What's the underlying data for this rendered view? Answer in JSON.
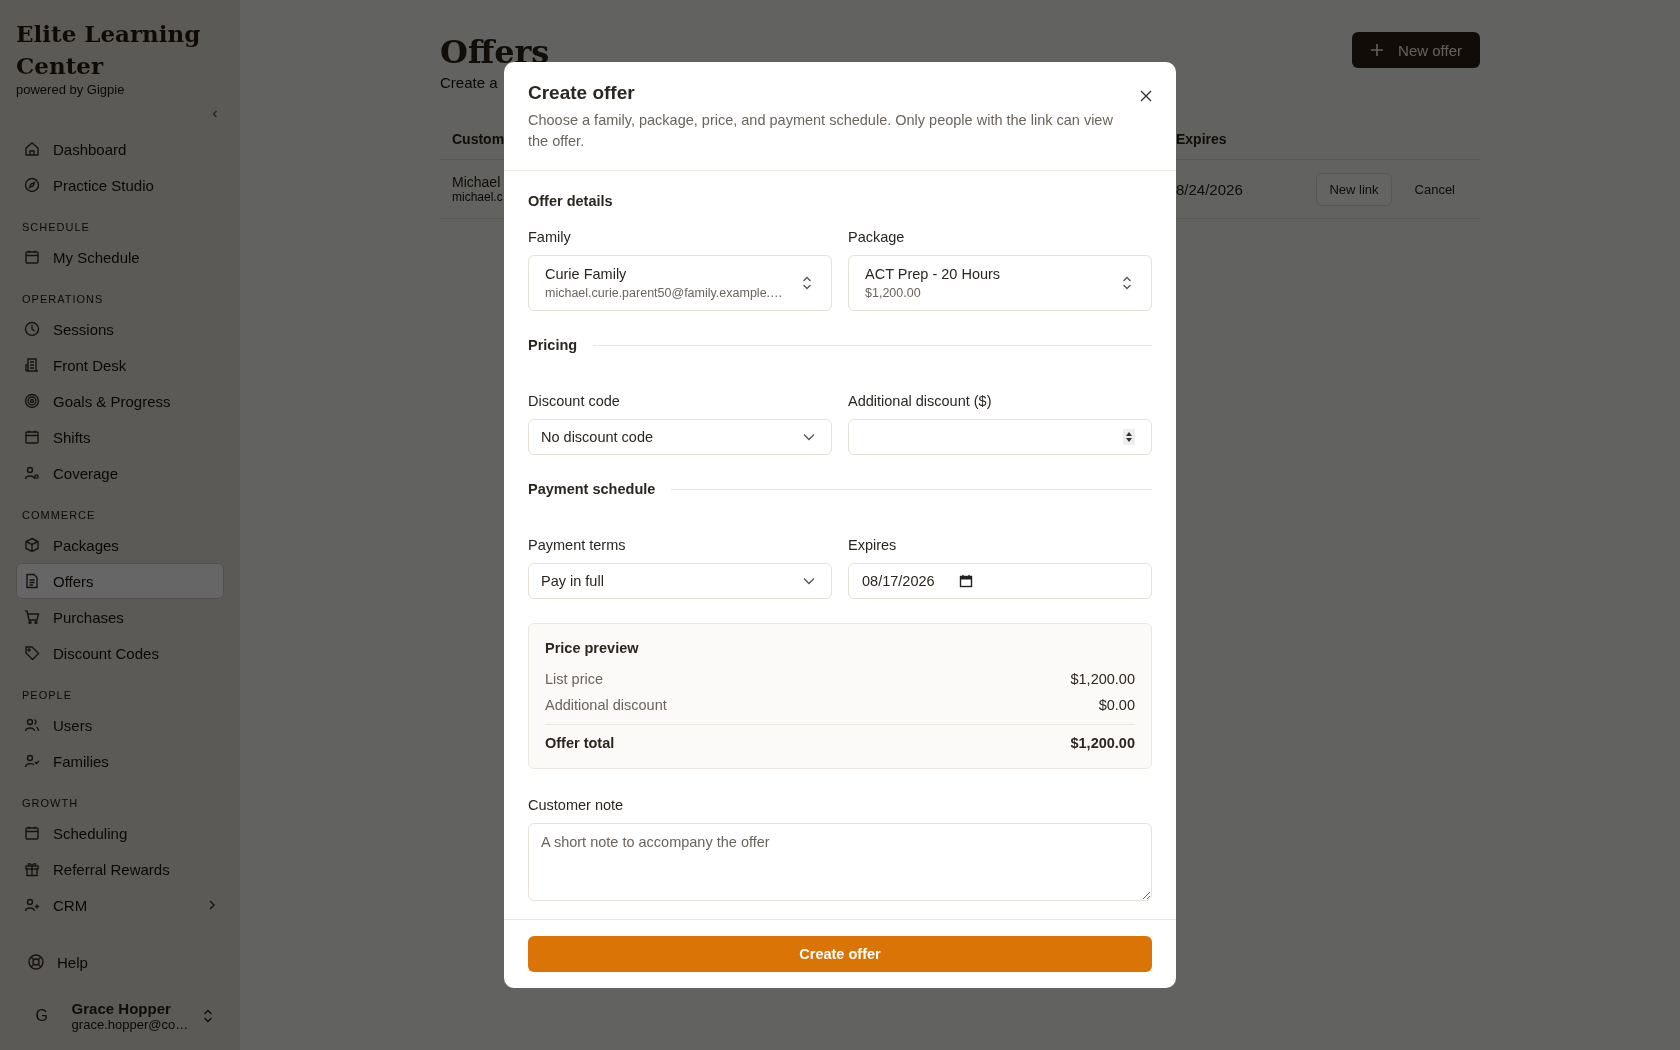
{
  "sidebar": {
    "brand": "Elite Learning Center",
    "tagline": "powered by Gigpie",
    "sections": [
      {
        "items": [
          {
            "label": "Dashboard",
            "selected": false
          },
          {
            "label": "Practice Studio",
            "selected": false
          }
        ]
      },
      {
        "heading": "SCHEDULE",
        "items": [
          {
            "label": "My Schedule",
            "selected": false
          }
        ]
      },
      {
        "heading": "OPERATIONS",
        "items": [
          {
            "label": "Sessions",
            "selected": false
          },
          {
            "label": "Front Desk",
            "selected": false
          },
          {
            "label": "Goals & Progress",
            "selected": false
          },
          {
            "label": "Shifts",
            "selected": false
          },
          {
            "label": "Coverage",
            "selected": false
          }
        ]
      },
      {
        "heading": "COMMERCE",
        "items": [
          {
            "label": "Packages",
            "selected": false
          },
          {
            "label": "Offers",
            "selected": true
          },
          {
            "label": "Purchases",
            "selected": false
          },
          {
            "label": "Discount Codes",
            "selected": false
          }
        ]
      },
      {
        "heading": "PEOPLE",
        "items": [
          {
            "label": "Users",
            "selected": false
          },
          {
            "label": "Families",
            "selected": false
          }
        ]
      },
      {
        "heading": "GROWTH",
        "items": [
          {
            "label": "Scheduling",
            "selected": false
          },
          {
            "label": "Referral Rewards",
            "selected": false
          },
          {
            "label": "CRM",
            "selected": false,
            "expanded": false
          }
        ]
      }
    ],
    "help": "Help",
    "user": {
      "initial": "G",
      "name": "Grace Hopper",
      "email": "grace.hopper@co…"
    }
  },
  "page": {
    "title": "Offers",
    "subtitle": "Create a",
    "new_button": "New offer",
    "table": {
      "columns": [
        "Custom",
        "Expires"
      ],
      "rows": [
        {
          "customer": "Michael",
          "email": "michael.c",
          "expires": "8/24/2026",
          "actions": [
            "New link",
            "Cancel"
          ]
        }
      ]
    }
  },
  "modal": {
    "title": "Create offer",
    "description": "Choose a family, package, price, and payment schedule. Only people with the link can view the offer.",
    "offer_details": {
      "heading": "Offer details",
      "family": {
        "label": "Family",
        "value": "Curie Family",
        "detail": "michael.curie.parent50@family.example.…"
      },
      "package": {
        "label": "Package",
        "value": "ACT Prep - 20 Hours",
        "detail": "$1,200.00"
      }
    },
    "pricing": {
      "heading": "Pricing",
      "discount_code": {
        "label": "Discount code",
        "value": "No discount code"
      },
      "additional_discount": {
        "label": "Additional discount ($)"
      }
    },
    "payment_schedule": {
      "heading": "Payment schedule",
      "payment_terms": {
        "label": "Payment terms",
        "value": "Pay in full"
      },
      "expires": {
        "label": "Expires",
        "value": "08/17/2026"
      }
    },
    "price_preview": {
      "title": "Price preview",
      "rows": [
        {
          "label": "List price",
          "value": "$1,200.00",
          "kind": "line"
        },
        {
          "label": "Additional discount",
          "value": "$0.00",
          "kind": "line"
        },
        {
          "label": "Offer total",
          "value": "$1,200.00",
          "kind": "total"
        }
      ]
    },
    "customer_note": {
      "label": "Customer note",
      "placeholder": "A short note to accompany the offer"
    },
    "submit": "Create offer"
  }
}
